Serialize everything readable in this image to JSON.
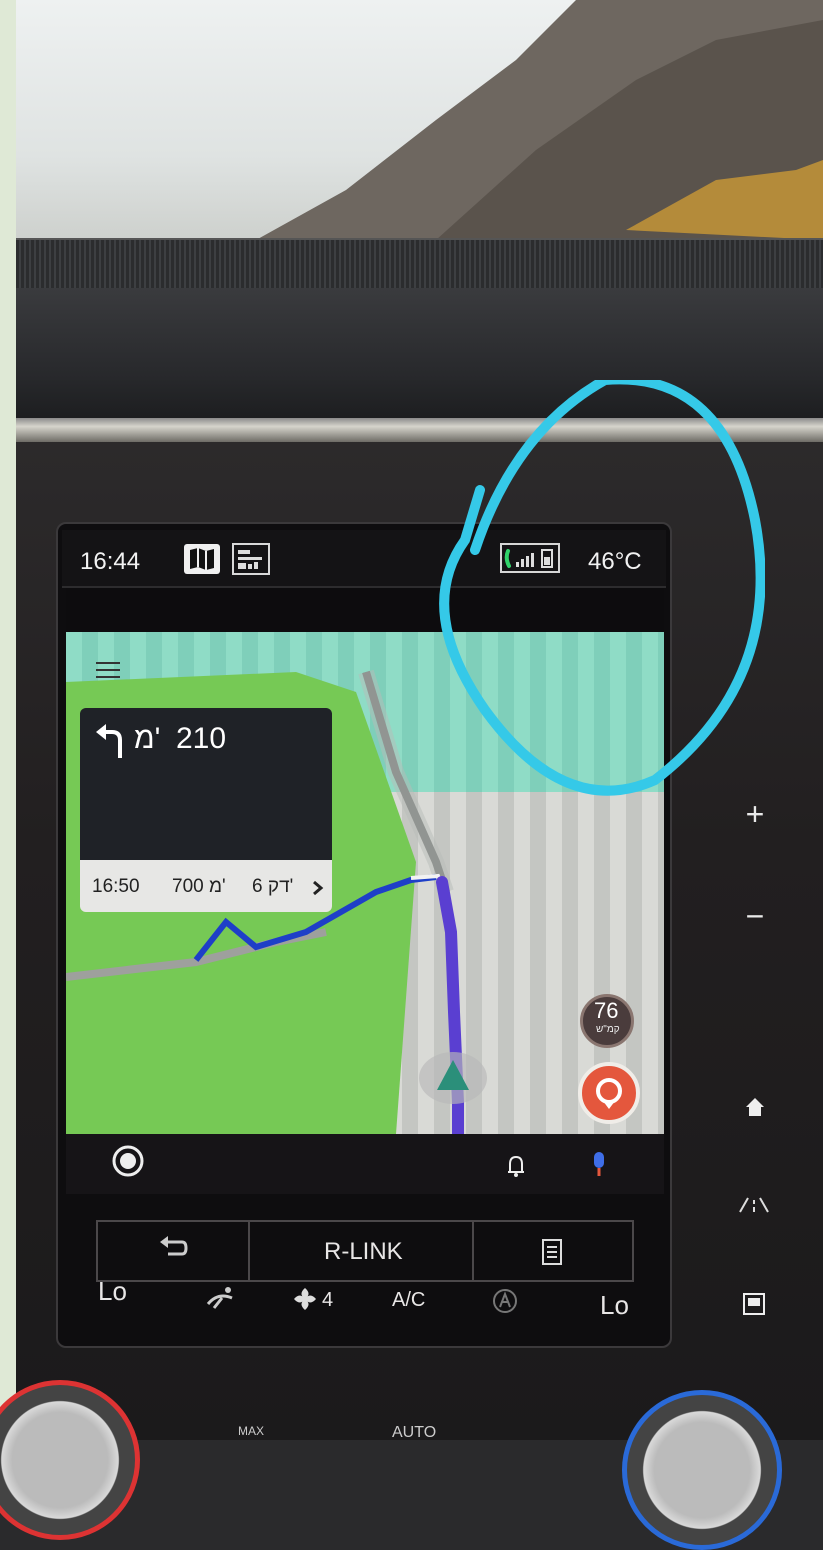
{
  "status_bar": {
    "time": "16:44",
    "temperature": "46°C",
    "icons": [
      "map-icon",
      "media-icon",
      "phone-icon",
      "signal-bars-icon",
      "battery-icon"
    ]
  },
  "navigation": {
    "menu_icon": "hamburger-icon",
    "turn_icon": "turn-left-arrow-icon",
    "distance_value": "210",
    "distance_unit": "מ'",
    "eta_time": "16:50",
    "eta_distance": "700 מ'",
    "eta_minutes": "6 דק'",
    "expand_icon": "chevron-right-icon",
    "speed_value": "76",
    "speed_unit": "קמ\"ש",
    "report_icon": "report-pin-icon",
    "position_icon": "position-arrow-icon"
  },
  "bottom_bar": {
    "left_icon": "record-icon",
    "notify_icon": "bell-icon",
    "mic_icon": "microphone-icon"
  },
  "climate": {
    "back_icon": "back-arrow-icon",
    "r_link_label": "R-LINK",
    "menu_icon": "list-icon",
    "left_temp": "Lo",
    "right_temp": "Lo",
    "airflow_icon": "airflow-icon",
    "fan_level": "4",
    "fan_icon": "fan-icon",
    "ac_label": "A/C",
    "auto_ac_icon": "auto-ac-icon"
  },
  "side_controls": {
    "zoom_in": "+",
    "zoom_out": "−",
    "home_icon": "home-icon",
    "road_icon": "road-icon",
    "screen_icon": "screen-icon"
  },
  "bottom_controls": {
    "auto_label": "AUTO",
    "max_label": "MAX"
  },
  "colors": {
    "route": "#1e3fc8",
    "route_current": "#5a3fd1",
    "map_green": "#7ccf5b",
    "annotation": "#35c9e8",
    "position_arrow": "#2b8f7a"
  }
}
